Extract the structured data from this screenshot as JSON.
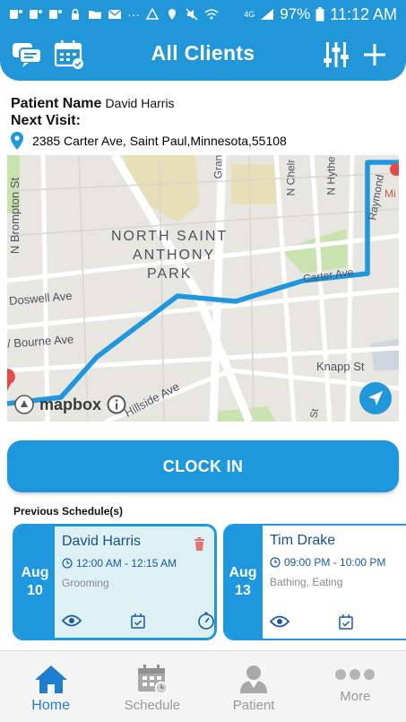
{
  "status_bar": {
    "battery": "97%",
    "time": "11:12 AM",
    "network": "4G"
  },
  "header": {
    "title": "All Clients",
    "icons": [
      "chat-icon",
      "calendar-icon",
      "filter-sliders-icon",
      "plus-icon"
    ]
  },
  "patient": {
    "name_label": "Patient Name",
    "name_value": "David Harris",
    "next_visit_label": "Next Visit:",
    "address": "2385 Carter Ave, Saint Paul,Minnesota,55108"
  },
  "map": {
    "area_label_1": "NORTH SAINT",
    "area_label_2": "ANTHONY",
    "area_label_3": "PARK",
    "streets": {
      "brompton": "N Brompton St",
      "doswell": "Doswell Ave",
      "bourne": "/ Bourne Ave",
      "hillside": "Hillside Ave",
      "knapp": "Knapp St",
      "carter": "Carter Ave",
      "chelmsford": "N Chelr",
      "hythe": "N Hythe",
      "raymond": "Raymond",
      "gran": "Gran",
      "st": "St"
    },
    "attribution": "mapbox",
    "poi": "Mi",
    "route_color": "#1e97de"
  },
  "clock_in_label": "CLOCK IN",
  "previous_schedule_label": "Previous Schedule(s)",
  "schedules": [
    {
      "month": "Aug",
      "day": "10",
      "client": "David Harris",
      "time": "12:00 AM - 12:15 AM",
      "services": "Grooming"
    },
    {
      "month": "Aug",
      "day": "13",
      "client": "Tim Drake",
      "time": "09:00 PM - 10:00 PM",
      "services": "Bathing, Eating"
    }
  ],
  "bottom_nav": [
    {
      "label": "Home",
      "icon": "home-icon",
      "active": true
    },
    {
      "label": "Schedule",
      "icon": "schedule-icon",
      "active": false
    },
    {
      "label": "Patient",
      "icon": "patient-icon",
      "active": false
    },
    {
      "label": "More",
      "icon": "more-icon",
      "active": false
    }
  ],
  "colors": {
    "primary": "#2196d9",
    "card_selected_bg": "#ddf0f4",
    "delete_red": "#e57373"
  }
}
